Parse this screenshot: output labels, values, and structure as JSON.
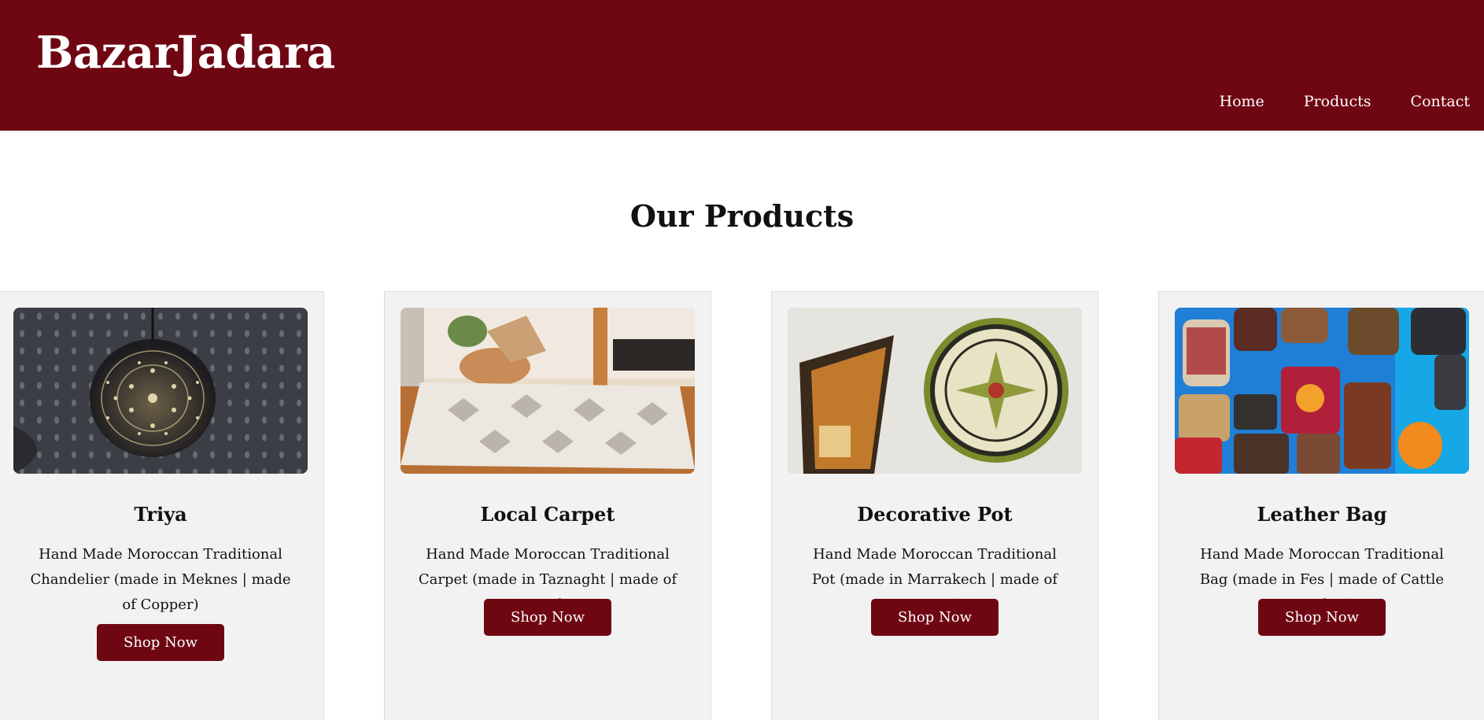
{
  "header": {
    "brand": "BazarJadara",
    "nav": [
      "Home",
      "Products",
      "Contact"
    ]
  },
  "section_title": "Our Products",
  "products": [
    {
      "name": "Triya",
      "description": "Hand Made Moroccan Traditional Chandelier (made in Meknes | made of Copper)",
      "button": "Shop Now",
      "image_icon": "chandelier-image"
    },
    {
      "name": "Local Carpet",
      "description": "Hand Made Moroccan Traditional Carpet (made in Taznaght | made of Wool)",
      "button": "Shop Now",
      "image_icon": "carpet-image"
    },
    {
      "name": "Decorative Pot",
      "description": "Hand Made Moroccan Traditional Pot (made in Marrakech | made of Pottery)",
      "button": "Shop Now",
      "image_icon": "pottery-plate-image"
    },
    {
      "name": "Leather Bag",
      "description": "Hand Made Moroccan Traditional Bag (made in Fes | made of Cattle Leather)",
      "button": "Shop Now",
      "image_icon": "leather-bags-image"
    }
  ],
  "colors": {
    "brand_maroon": "#6f0713",
    "card_bg": "#f2f2f2",
    "page_bg": "#ffffff"
  }
}
